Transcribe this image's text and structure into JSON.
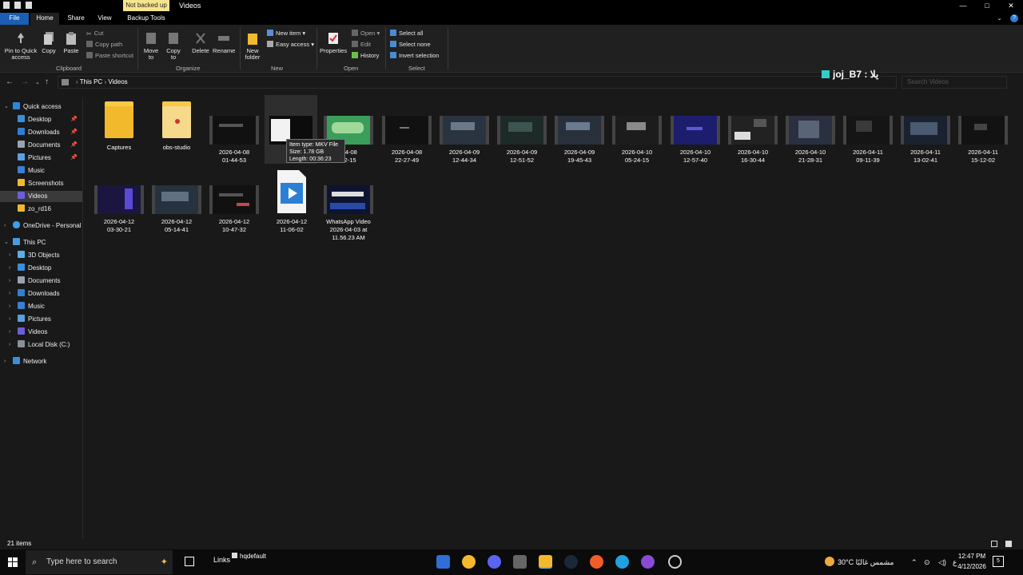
{
  "window": {
    "title": "Videos",
    "context_tab": "Not backed up",
    "controls": [
      "—",
      "□",
      "✕"
    ]
  },
  "tabs": [
    "File",
    "Home",
    "Share",
    "View",
    "Backup Tools"
  ],
  "ribbon": {
    "clipboard": {
      "group": "Clipboard",
      "pin": "Pin to Quick access",
      "copy": "Copy",
      "paste": "Paste",
      "cut": "Cut",
      "copy_path": "Copy path",
      "paste_shortcut": "Paste shortcut"
    },
    "organize": {
      "group": "Organize",
      "move_to": "Move to",
      "copy_to": "Copy to",
      "delete": "Delete",
      "rename": "Rename"
    },
    "new": {
      "group": "New",
      "new_folder": "New folder",
      "new_item": "New item",
      "easy_access": "Easy access"
    },
    "open": {
      "group": "Open",
      "properties": "Properties",
      "open": "Open",
      "edit": "Edit",
      "history": "History"
    },
    "select": {
      "group": "Select",
      "select_all": "Select all",
      "select_none": "Select none",
      "invert": "Invert selection"
    }
  },
  "address": {
    "path": [
      "This PC",
      "Videos"
    ],
    "search_placeholder": "Search Videos"
  },
  "overlay_text": "joj_B7 : یلا",
  "sidebar": {
    "quick_access": "Quick access",
    "quick_items": [
      "Desktop",
      "Downloads",
      "Documents",
      "Pictures",
      "Music",
      "Screenshots",
      "Videos",
      "zo_rd16"
    ],
    "onedrive": "OneDrive - Personal",
    "this_pc": "This PC",
    "pc_items": [
      "3D Objects",
      "Desktop",
      "Documents",
      "Downloads",
      "Music",
      "Pictures",
      "Videos",
      "Local Disk (C:)"
    ],
    "network": "Network"
  },
  "files": [
    {
      "name": "Captures",
      "l2": ""
    },
    {
      "name": "obs-studio",
      "l2": ""
    },
    {
      "name": "2026-04-08",
      "l2": "01-44-53"
    },
    {
      "name": "202",
      "l2": "02"
    },
    {
      "name": "-04-08",
      "l2": "32-15"
    },
    {
      "name": "2026-04-08",
      "l2": "22-27-49"
    },
    {
      "name": "2026-04-09",
      "l2": "12-44-34"
    },
    {
      "name": "2026-04-09",
      "l2": "12-51-52"
    },
    {
      "name": "2026-04-09",
      "l2": "19-45-43"
    },
    {
      "name": "2026-04-10",
      "l2": "05-24-15"
    },
    {
      "name": "2026-04-10",
      "l2": "12-57-40"
    },
    {
      "name": "2026-04-10",
      "l2": "16-30-44"
    },
    {
      "name": "2026-04-10",
      "l2": "21-28-31"
    },
    {
      "name": "2026-04-11",
      "l2": "09-11-39"
    },
    {
      "name": "2026-04-11",
      "l2": "13-02-41"
    },
    {
      "name": "2026-04-11",
      "l2": "15-12-02"
    },
    {
      "name": "2026-04-12",
      "l2": "03-30-21"
    },
    {
      "name": "2026-04-12",
      "l2": "05-14-41"
    },
    {
      "name": "2026-04-12",
      "l2": "10-47-32"
    },
    {
      "name": "2026-04-12",
      "l2": "11-06-02"
    },
    {
      "name": "WhatsApp Video",
      "l2": "2026-04-03 at",
      "l3": "11.56.23 AM"
    }
  ],
  "tooltip": {
    "type": "Item type: MKV File",
    "size": "Size: 1.78 GB",
    "length": "Length: 00:36:23"
  },
  "status": {
    "count": "21 items"
  },
  "taskbar": {
    "search_placeholder": "Type here to search",
    "links": "Links",
    "hqdefault": "hqdefault",
    "weather": "30°C مشمس غالبًا",
    "time": "12:47 PM",
    "date": "4/12/2026",
    "lang": "ع",
    "notif_count": "5"
  }
}
